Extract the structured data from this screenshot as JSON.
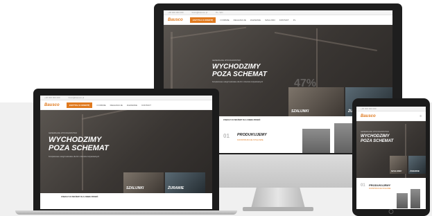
{
  "site": {
    "logo": "Bausco",
    "topbar": [
      "+48 000 000 000",
      "biuro@bausco.pl",
      "PL / EN"
    ],
    "nav": [
      "O FIRMIE",
      "REALIZACJE",
      "ZLEWANIE",
      "SZALUNKI",
      "KONTAKT"
    ],
    "nav_active": "ZAPYTAJ O OFERTĘ",
    "lang": "PL"
  },
  "hero": {
    "kicker": "GENERALNE WYKONAWSTWO",
    "title_line1": "WYCHODZIMY",
    "title_line2": "POZA SCHEMAT",
    "text": "Kompleksowe usługi budowlane dla firm i klientów indywidualnych",
    "percent": "47%"
  },
  "tiles": {
    "first": "SZALUNKI",
    "second": "ŻURAWIE"
  },
  "cta": {
    "text": "ZOBACZ CO MOŻEMY DLA CIEBIE ZROBIĆ"
  },
  "produce": {
    "number": "01",
    "title": "PRODUKUJEMY",
    "subtitle": "KONSTRUKCJE STALOWE"
  },
  "device": {
    "apple_logo": ""
  }
}
